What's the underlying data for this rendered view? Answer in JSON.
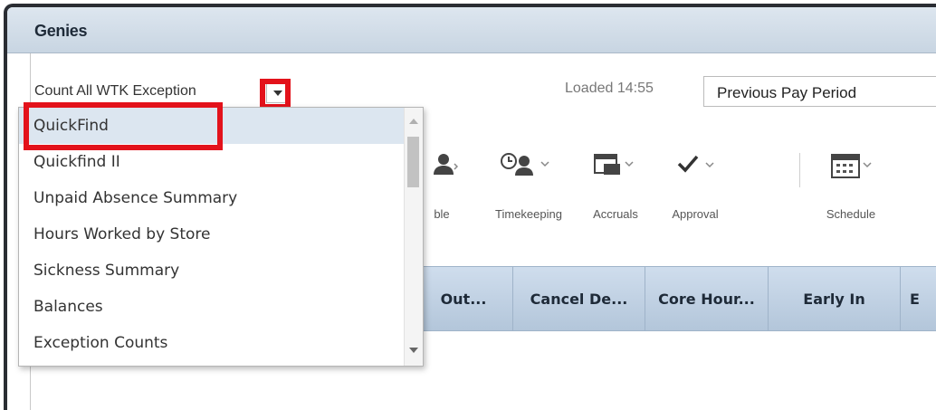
{
  "window": {
    "title": "Genies"
  },
  "genie": {
    "selected": "Count All WTK Exception",
    "loaded_label": "Loaded 14:55",
    "time_period": "Previous Pay Period"
  },
  "toolbar": [
    {
      "label": "ble",
      "icon": "people-icon"
    },
    {
      "label": "Timekeeping",
      "icon": "clock-person-icon"
    },
    {
      "label": "Accruals",
      "icon": "accruals-icon"
    },
    {
      "label": "Approval",
      "icon": "checkmark-icon"
    },
    {
      "label": "Schedule",
      "icon": "calendar-icon"
    }
  ],
  "columns": [
    "Out...",
    "Cancel De...",
    "Core Hour...",
    "Early In",
    "E"
  ],
  "dropdown": {
    "items": [
      "QuickFind",
      "Quickfind II",
      "Unpaid Absence Summary",
      "Hours Worked by Store",
      "Sickness Summary",
      "Balances",
      "Exception Counts"
    ],
    "selected_index": 0
  },
  "colors": {
    "highlight": "#e3121b",
    "header_blue": "#c3d3e4"
  }
}
